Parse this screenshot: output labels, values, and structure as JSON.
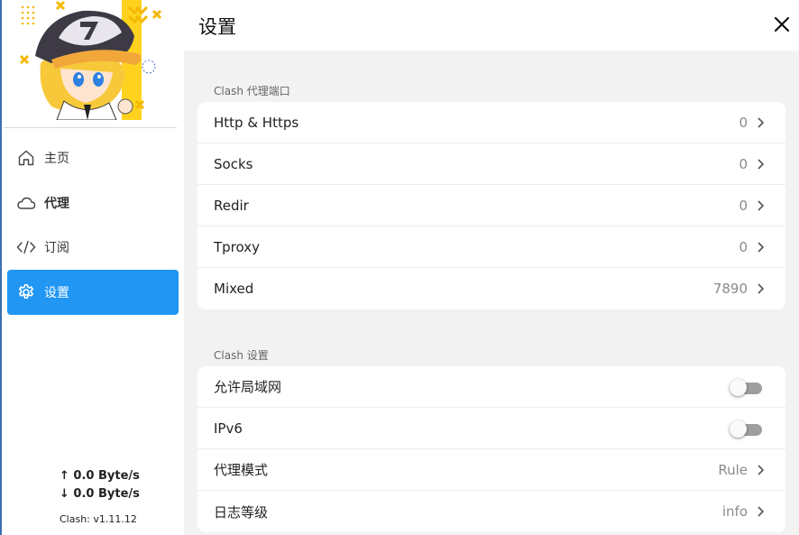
{
  "sidebar": {
    "nav": [
      {
        "label": "主页",
        "icon": "home-icon"
      },
      {
        "label": "代理",
        "icon": "cloud-icon"
      },
      {
        "label": "订阅",
        "icon": "code-icon"
      },
      {
        "label": "设置",
        "icon": "gear-icon"
      }
    ],
    "upload_speed": "↑ 0.0 Byte/s",
    "download_speed": "↓ 0.0 Byte/s",
    "version": "Clash: v1.11.12",
    "accent_color": "#2196f3"
  },
  "header": {
    "title": "设置"
  },
  "ports_section": {
    "label": "Clash 代理端口",
    "rows": [
      {
        "label": "Http & Https",
        "value": "0"
      },
      {
        "label": "Socks",
        "value": "0"
      },
      {
        "label": "Redir",
        "value": "0"
      },
      {
        "label": "Tproxy",
        "value": "0"
      },
      {
        "label": "Mixed",
        "value": "7890"
      }
    ]
  },
  "clash_section": {
    "label": "Clash 设置",
    "rows": [
      {
        "label": "允许局域网",
        "toggle": false
      },
      {
        "label": "IPv6",
        "toggle": false
      },
      {
        "label": "代理模式",
        "value": "Rule"
      },
      {
        "label": "日志等级",
        "value": "info"
      }
    ]
  }
}
